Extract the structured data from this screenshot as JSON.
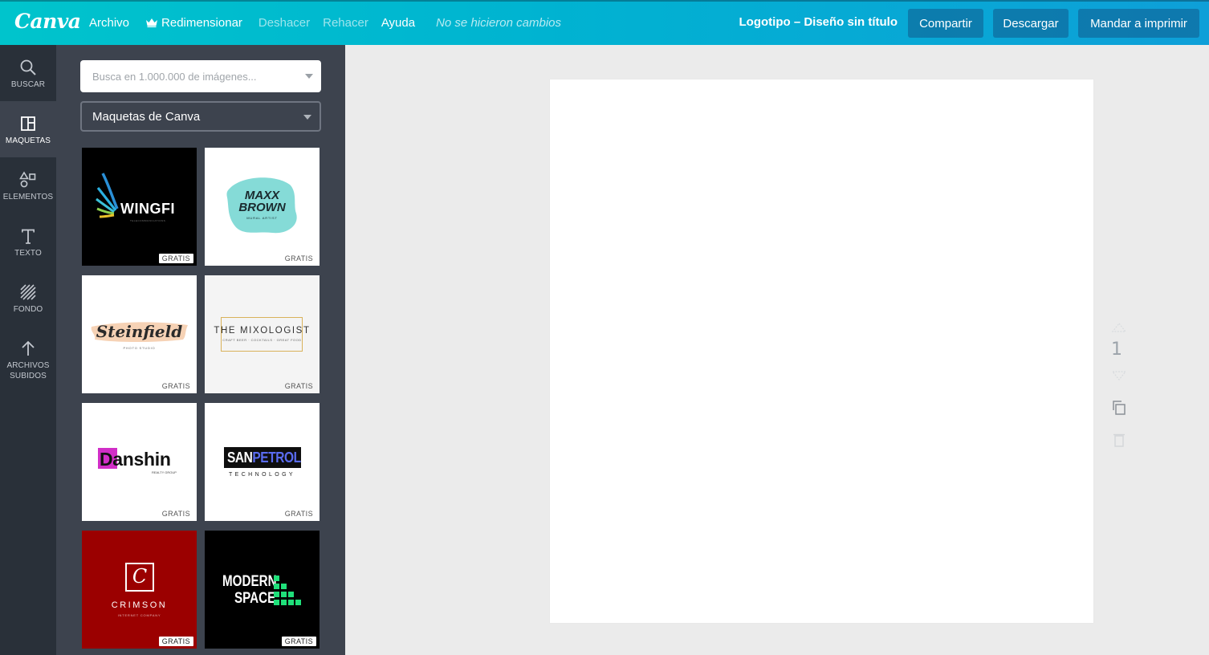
{
  "topbar": {
    "logo": "Canva",
    "menu": [
      {
        "label": "Archivo",
        "dim": false
      },
      {
        "label": "Redimensionar",
        "dim": false,
        "icon": "crown-icon"
      },
      {
        "label": "Deshacer",
        "dim": true
      },
      {
        "label": "Rehacer",
        "dim": true
      },
      {
        "label": "Ayuda",
        "dim": false
      }
    ],
    "status": "No se hicieron cambios",
    "doc_title": "Logotipo – Diseño sin título",
    "share_label": "Compartir",
    "download_label": "Descargar",
    "print_label": "Mandar a imprimir"
  },
  "rail": [
    {
      "label": "BUSCAR",
      "icon": "search-icon"
    },
    {
      "label": "MAQUETAS",
      "icon": "layout-icon",
      "active": true
    },
    {
      "label": "ELEMENTOS",
      "icon": "shapes-icon"
    },
    {
      "label": "TEXTO",
      "icon": "text-icon"
    },
    {
      "label": "FONDO",
      "icon": "background-icon"
    },
    {
      "label": "ARCHIVOS",
      "label2": "SUBIDOS",
      "icon": "upload-icon"
    }
  ],
  "panel": {
    "search_placeholder": "Busca en 1.000.000 de imágenes...",
    "category": "Maquetas de Canva",
    "templates": [
      {
        "name": "WINGFI",
        "sub": "TELECOMMUNICATIONS",
        "badge": "GRATIS"
      },
      {
        "name": "MAXX",
        "name2": "BROWN",
        "sub": "MURAL ARTIST",
        "badge": "GRATIS"
      },
      {
        "name": "Steinfield",
        "sub": "PHOTO STUDIO",
        "badge": "GRATIS"
      },
      {
        "name": "THE MIXOLOGIST",
        "sub": "CRAFT BEER · COCKTAILS · GREAT FOOD",
        "badge": "GRATIS"
      },
      {
        "name": "Danshin",
        "sub": "REALTY GROUP",
        "badge": "GRATIS"
      },
      {
        "name": "SAN",
        "name2": "PETROL",
        "sub": "TECHNOLOGY",
        "badge": "GRATIS"
      },
      {
        "name": "CRIMSON",
        "sub": "INTERNET COMPANY",
        "badge": "GRATIS"
      },
      {
        "name": "MODERN",
        "name2": "SPACE",
        "badge": "GRATIS"
      }
    ]
  },
  "canvas": {
    "page_number": "1"
  },
  "colors": {
    "topbar_start": "#00c4cc",
    "topbar_end": "#0e9fd8",
    "rail_bg": "#293039",
    "panel_bg": "#3d434e",
    "stage_bg": "#ebebeb"
  }
}
